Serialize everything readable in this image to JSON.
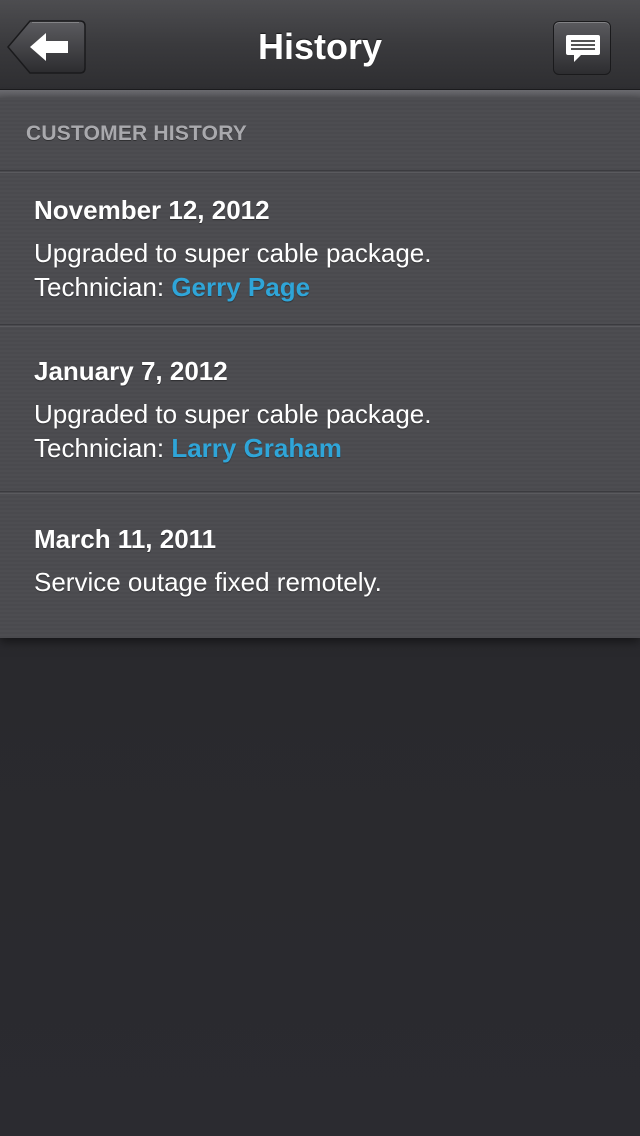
{
  "nav": {
    "title": "History",
    "back_icon": "back-arrow-icon",
    "chat_icon": "chat-bubble-icon"
  },
  "section": {
    "header": "CUSTOMER HISTORY"
  },
  "history": [
    {
      "date": "November 12, 2012",
      "description": "Upgraded to super cable package.",
      "technician_label": "Technician: ",
      "technician_name": "Gerry Page"
    },
    {
      "date": "January 7, 2012",
      "description": "Upgraded to super cable package.",
      "technician_label": "Technician: ",
      "technician_name": "Larry Graham"
    },
    {
      "date": "March 11, 2011",
      "description": "Service outage fixed remotely."
    }
  ],
  "colors": {
    "link": "#2fa5d8",
    "header_text": "#a9a9ad"
  }
}
